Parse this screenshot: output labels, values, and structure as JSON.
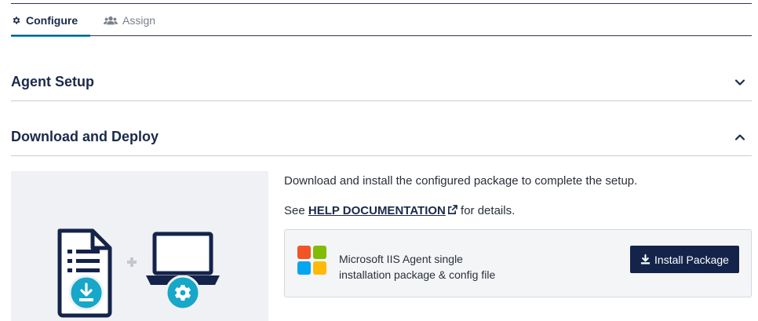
{
  "tabs": [
    {
      "label": "Configure",
      "icon": "gear-icon",
      "active": true
    },
    {
      "label": "Assign",
      "icon": "users-icon",
      "active": false
    }
  ],
  "sections": [
    {
      "title": "Agent Setup",
      "expanded": false
    },
    {
      "title": "Download and Deploy",
      "expanded": true
    }
  ],
  "deploy": {
    "description": "Download and install the configured package to complete the setup.",
    "see_prefix": "See",
    "help_link": "HELP DOCUMENTATION",
    "see_suffix": "for details.",
    "package": {
      "line1": "Microsoft IIS Agent single",
      "line2": "installation package & config file",
      "button_label": "Install Package",
      "logo": "windows-logo"
    }
  },
  "colors": {
    "accent": "#16a7c9",
    "navy": "#14234a",
    "panel": "#f0f1f4"
  }
}
